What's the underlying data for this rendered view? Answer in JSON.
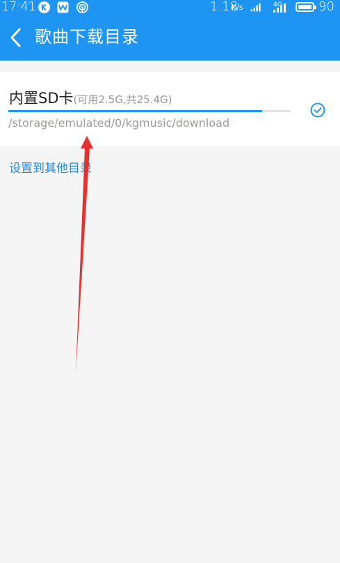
{
  "status_bar": {
    "time": "17:41",
    "network_speed": "1.18",
    "network_speed_unit": "K/s",
    "network_type": "4G",
    "battery_level": "90",
    "icons": [
      "k-app-icon",
      "wps-icon",
      "hotspot-icon",
      "signal-icon",
      "signal-4g-icon",
      "battery-icon"
    ]
  },
  "header": {
    "back_icon": "chevron-left-icon",
    "title": "歌曲下载目录"
  },
  "storage": {
    "name": "内置SD卡",
    "capacity": "(可用2.5G,共25.4G)",
    "used_fraction": 0.9,
    "path": "/storage/emulated/0/kgmusic/download",
    "selected_icon": "check-circle-icon"
  },
  "other_dir_label": "设置到其他目录",
  "colors": {
    "accent": "#1e95f2",
    "link": "#2a8ad8",
    "annotation_arrow": "#e8302e"
  }
}
